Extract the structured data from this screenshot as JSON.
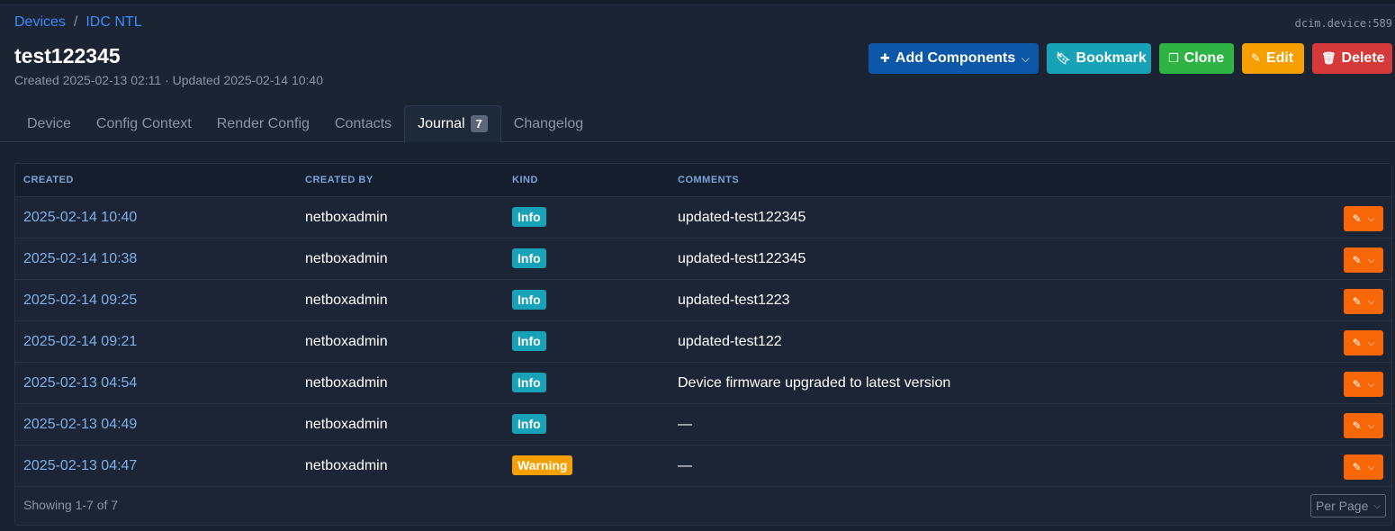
{
  "breadcrumb": {
    "root": "Devices",
    "separator": "/",
    "site": "IDC NTL"
  },
  "object_id": "dcim.device:589",
  "page_title": "test122345",
  "meta": "Created 2025-02-13 02:11 · Updated 2025-02-14 10:40",
  "actions": {
    "add_components": "Add Components",
    "bookmark": "Bookmark",
    "clone": "Clone",
    "edit": "Edit",
    "delete": "Delete"
  },
  "tabs": [
    {
      "label": "Device"
    },
    {
      "label": "Config Context"
    },
    {
      "label": "Render Config"
    },
    {
      "label": "Contacts"
    },
    {
      "label": "Journal",
      "count": "7",
      "active": true
    },
    {
      "label": "Changelog"
    }
  ],
  "table": {
    "headers": [
      "CREATED",
      "CREATED BY",
      "KIND",
      "COMMENTS"
    ],
    "rows": [
      {
        "created": "2025-02-14 10:40",
        "created_by": "netboxadmin",
        "kind": "Info",
        "comments": "updated-test122345"
      },
      {
        "created": "2025-02-14 10:38",
        "created_by": "netboxadmin",
        "kind": "Info",
        "comments": "updated-test122345"
      },
      {
        "created": "2025-02-14 09:25",
        "created_by": "netboxadmin",
        "kind": "Info",
        "comments": "updated-test1223"
      },
      {
        "created": "2025-02-14 09:21",
        "created_by": "netboxadmin",
        "kind": "Info",
        "comments": "updated-test122"
      },
      {
        "created": "2025-02-13 04:54",
        "created_by": "netboxadmin",
        "kind": "Info",
        "comments": "Device firmware upgraded to latest version"
      },
      {
        "created": "2025-02-13 04:49",
        "created_by": "netboxadmin",
        "kind": "Info",
        "comments": "—"
      },
      {
        "created": "2025-02-13 04:47",
        "created_by": "netboxadmin",
        "kind": "Warning",
        "comments": "—"
      }
    ],
    "footer": "Showing 1-7 of 7",
    "per_page": "Per Page"
  },
  "colors": {
    "info": "#17a2b8",
    "warning": "#f59f00",
    "row_action": "#f76707",
    "link": "#3d8bfd"
  },
  "icons": {
    "add": "plus-icon",
    "bookmark": "bookmark-icon",
    "clone": "copy-icon",
    "edit": "pencil-icon",
    "delete": "trash-icon"
  }
}
